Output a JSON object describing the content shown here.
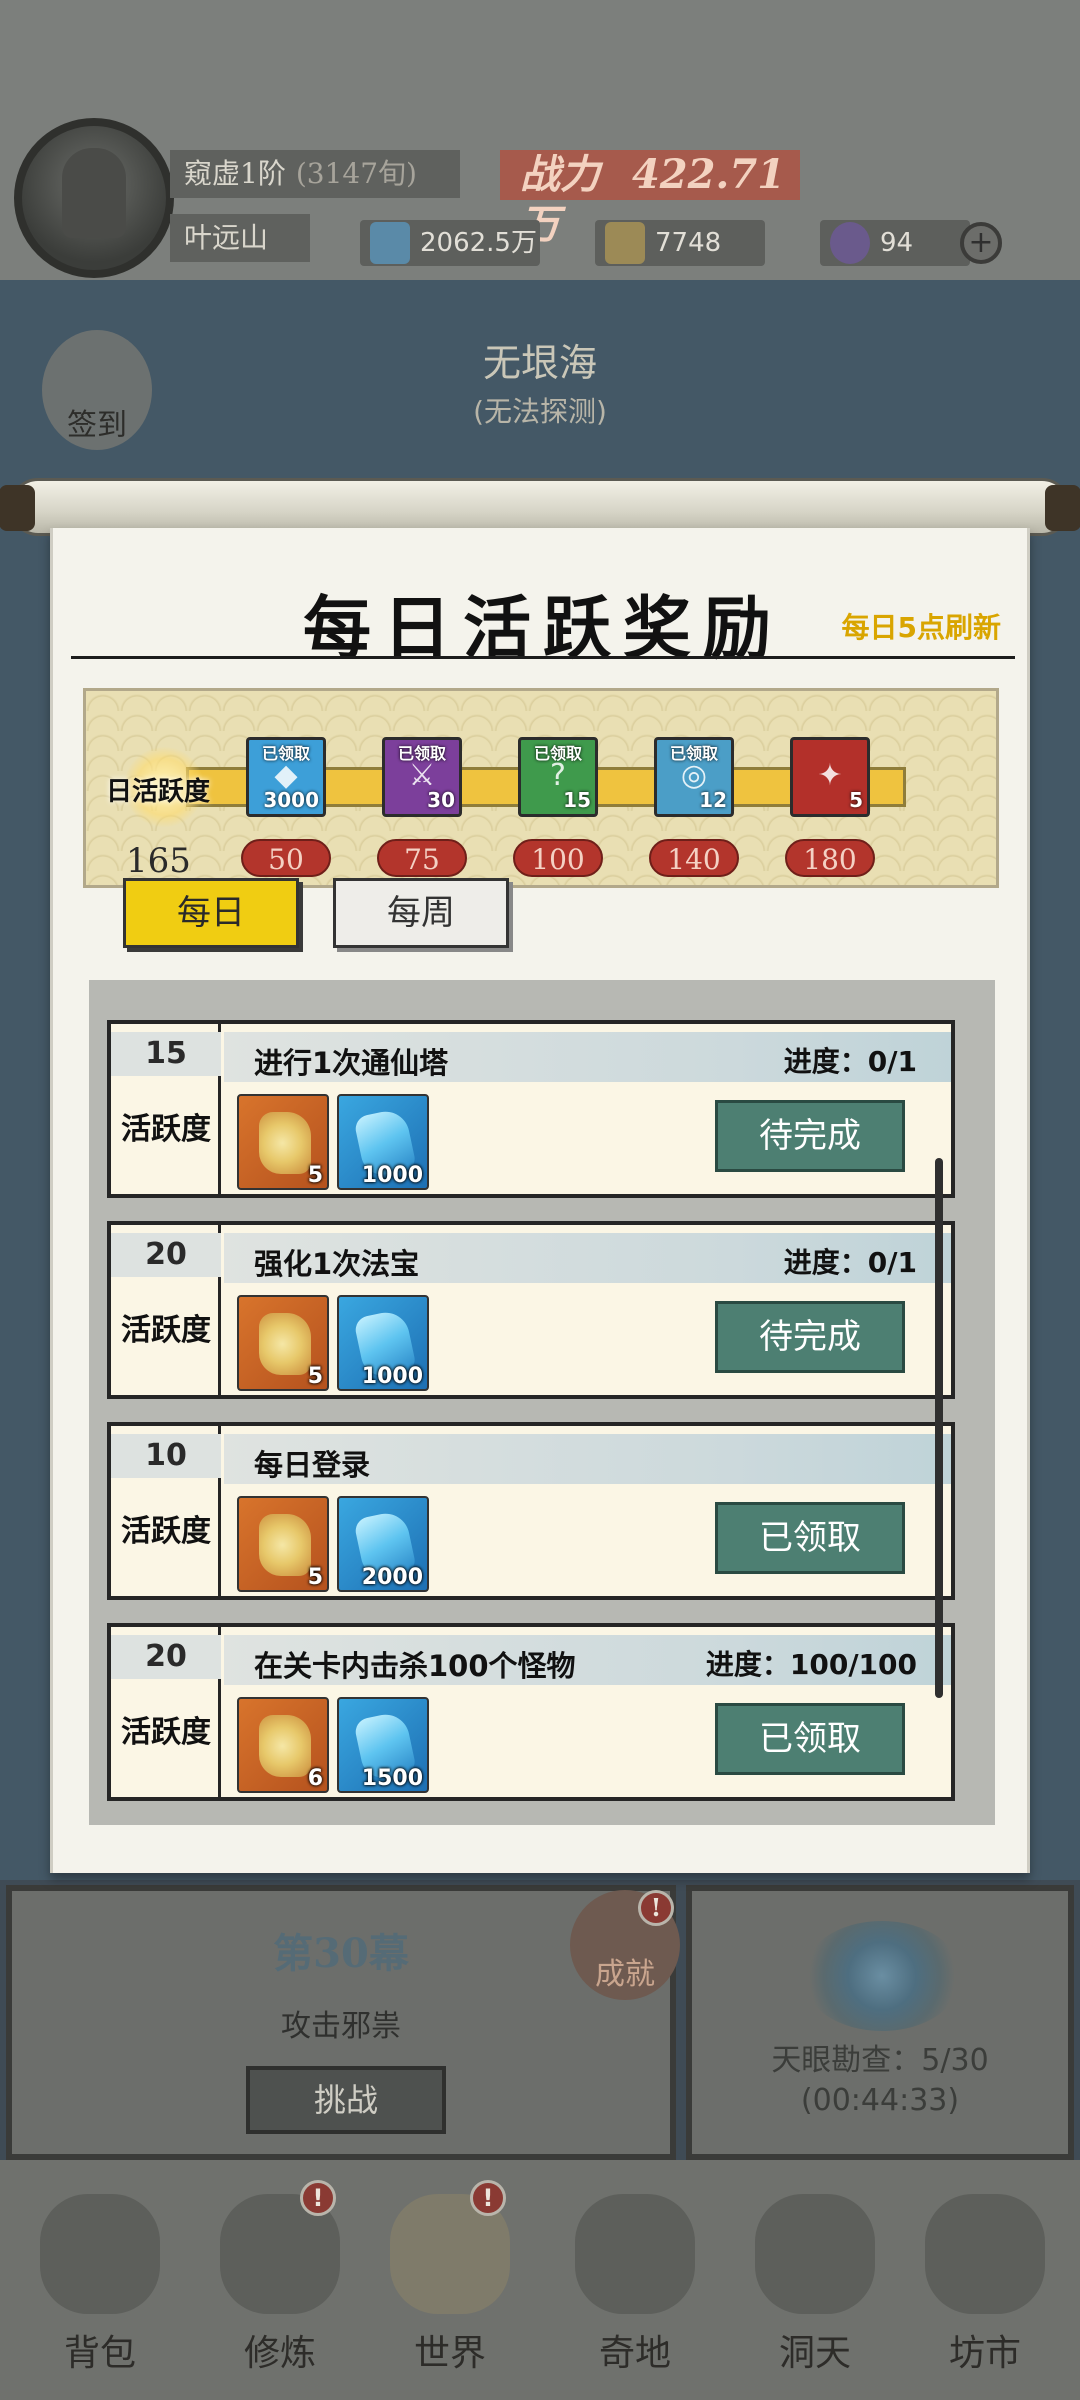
{
  "player": {
    "realm": "窥虚1阶",
    "realm_extra": "(3147旬)",
    "name": "叶远山",
    "power_label": "战力",
    "power_value": "422.71万"
  },
  "resources": [
    {
      "icon": "spirit-crystal-icon",
      "label": "灵晶",
      "value": "2062.5万"
    },
    {
      "icon": "evolution-stone-icon",
      "label": "进化石",
      "value": "7748"
    },
    {
      "icon": "purple-flame-icon",
      "label": "",
      "value": "94"
    }
  ],
  "map": {
    "title": "无垠海",
    "subtitle": "(无法探测)",
    "sign_in": "签到"
  },
  "modal": {
    "title": "每日活跃奖励",
    "refresh_note": "每日5点刷新",
    "activity_label": "日活跃度",
    "activity_value": "165",
    "chests": [
      {
        "claimed": "已领取",
        "count": "3000",
        "color": "#3d9fd8",
        "glyph": "◆",
        "milestone": "50"
      },
      {
        "claimed": "已领取",
        "count": "30",
        "color": "#7c3f9b",
        "glyph": "⚔",
        "milestone": "75"
      },
      {
        "claimed": "已领取",
        "count": "15",
        "color": "#3f9a4c",
        "glyph": "?",
        "milestone": "100"
      },
      {
        "claimed": "已领取",
        "count": "12",
        "color": "#4b9ec7",
        "glyph": "◎",
        "milestone": "140"
      },
      {
        "claimed": "",
        "count": "5",
        "color": "#b3302a",
        "glyph": "✦",
        "milestone": "180"
      }
    ],
    "tabs": {
      "daily": "每日",
      "weekly": "每周"
    },
    "tasks": [
      {
        "points": "15",
        "unit": "活跃度",
        "name": "进行1次通仙塔",
        "progress": "进度：0/1",
        "rewards": [
          {
            "type": "stone",
            "qty": "5"
          },
          {
            "type": "crystal",
            "qty": "1000"
          }
        ],
        "button": "待完成"
      },
      {
        "points": "20",
        "unit": "活跃度",
        "name": "强化1次法宝",
        "progress": "进度：0/1",
        "rewards": [
          {
            "type": "stone",
            "qty": "5"
          },
          {
            "type": "crystal",
            "qty": "1000"
          }
        ],
        "button": "待完成"
      },
      {
        "points": "10",
        "unit": "活跃度",
        "name": "每日登录",
        "progress": "",
        "rewards": [
          {
            "type": "stone",
            "qty": "5"
          },
          {
            "type": "crystal",
            "qty": "2000"
          }
        ],
        "button": "已领取"
      },
      {
        "points": "20",
        "unit": "活跃度",
        "name": "在关卡内击杀100个怪物",
        "progress": "进度：100/100",
        "rewards": [
          {
            "type": "stone",
            "qty": "6"
          },
          {
            "type": "crystal",
            "qty": "1500"
          }
        ],
        "button": "已领取"
      }
    ]
  },
  "stage": {
    "chapter": "第30幕",
    "subtitle": "攻击邪祟",
    "challenge": "挑战",
    "achievement": "成就"
  },
  "sky_eye": {
    "line1": "天眼勘查：5/30",
    "line2": "(00:44:33)"
  },
  "tabbar": [
    {
      "label": "背包",
      "icon": "bag-icon",
      "badge": ""
    },
    {
      "label": "修炼",
      "icon": "lotus-icon",
      "badge": "!"
    },
    {
      "label": "世界",
      "icon": "scroll-icon",
      "badge": "!"
    },
    {
      "label": "奇地",
      "icon": "pavilion-icon",
      "badge": ""
    },
    {
      "label": "洞天",
      "icon": "portal-icon",
      "badge": ""
    },
    {
      "label": "坊市",
      "icon": "market-icon",
      "badge": ""
    }
  ],
  "colors": {
    "accent_yellow": "#f0cd12",
    "button_teal": "#4d7f72",
    "milestone_red": "#b3352c",
    "refresh_gold": "#d9a500"
  }
}
